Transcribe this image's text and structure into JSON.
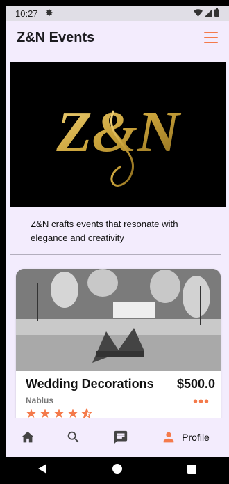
{
  "status_bar": {
    "time": "10:27"
  },
  "app_bar": {
    "title": "Z&N Events"
  },
  "banner": {
    "logo_text": "Z&N"
  },
  "description": "Z&N crafts events that resonate with elegance and creativity",
  "event_card": {
    "title": "Wedding Decorations",
    "price": "$500.0",
    "location": "Nablus",
    "rating": 4.5,
    "rating_max": 5
  },
  "bottom_nav": {
    "items": [
      {
        "icon": "home-icon"
      },
      {
        "icon": "search-icon"
      },
      {
        "icon": "chat-icon"
      },
      {
        "icon": "person-icon",
        "label": "Profile"
      }
    ]
  },
  "colors": {
    "accent": "#f47a4b",
    "background": "#f3ecfd",
    "gold": "#c9a23a"
  }
}
